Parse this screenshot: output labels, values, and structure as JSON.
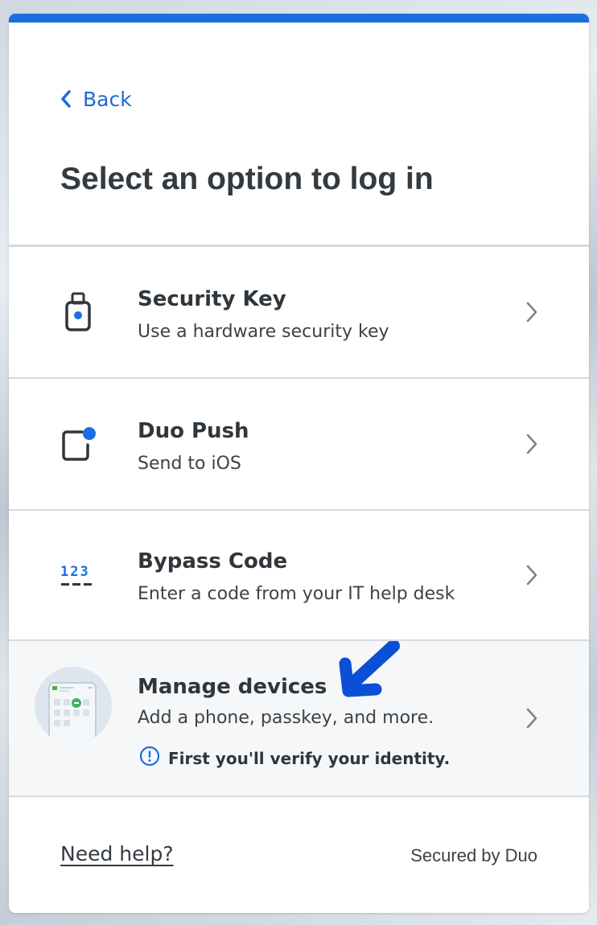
{
  "header": {
    "back_label": "Back",
    "title": "Select an option to log in"
  },
  "options": [
    {
      "name": "Security Key",
      "description": "Use a hardware security key",
      "icon": "usb-key-icon"
    },
    {
      "name": "Duo Push",
      "description": "Send to iOS",
      "icon": "phone-notification-icon"
    },
    {
      "name": "Bypass Code",
      "description": "Enter a code from your IT help desk",
      "icon": "bypass-code-icon",
      "icon_text": "123"
    },
    {
      "name": "Manage devices",
      "description": "Add a phone, passkey, and more.",
      "icon": "manage-devices-illustration",
      "notice": "First you'll verify your identity."
    }
  ],
  "footer": {
    "help_label": "Need help?",
    "secured_label": "Secured by Duo"
  },
  "colors": {
    "accent": "#1a6fe0",
    "text": "#333a40",
    "divider": "#d6dbe0",
    "annotation_arrow": "#0a4fd6"
  }
}
